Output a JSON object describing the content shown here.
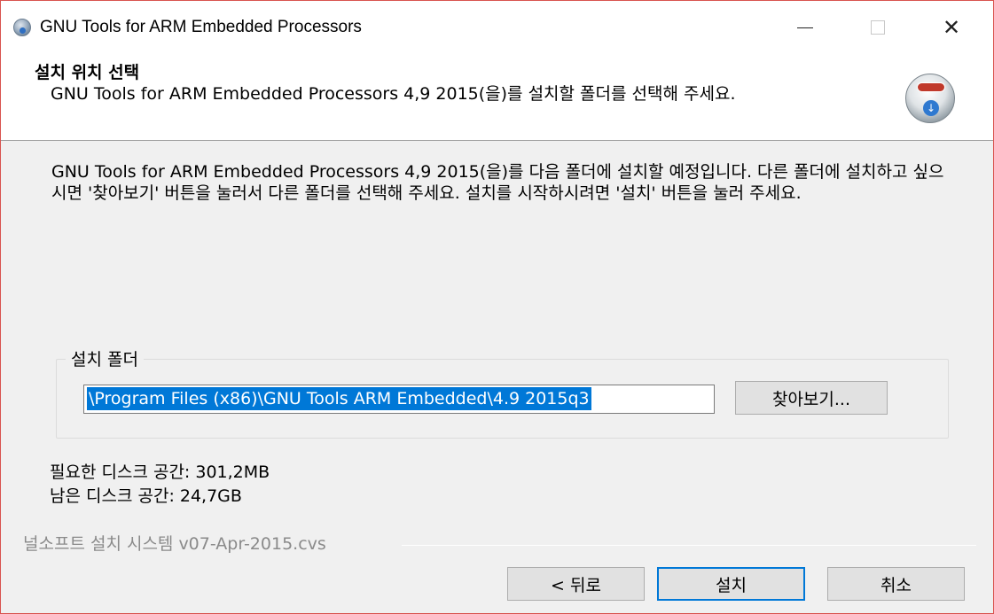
{
  "window": {
    "title": "GNU Tools for ARM Embedded Processors",
    "controls": [
      "minimize",
      "maximize",
      "close"
    ]
  },
  "header": {
    "heading": "설치 위치 선택",
    "subheading": "GNU Tools for ARM Embedded Processors 4,9 2015(을)를 설치할 폴더를 선택해 주세요.",
    "icon": "installer-icon"
  },
  "body": {
    "description": "GNU Tools for ARM Embedded Processors 4,9 2015(을)를 다음 폴더에 설치할 예정입니다. 다른 폴더에 설치하고 싶으시면 '찾아보기' 버튼을 눌러서 다른 폴더를 선택해 주세요. 설치를 시작하시려면 '설치' 버튼을 눌러 주세요.",
    "group_label": "설치 폴더",
    "install_path": "\\Program Files (x86)\\GNU Tools ARM Embedded\\4.9 2015q3",
    "browse_label": "찾아보기...",
    "required_space": "필요한 디스크 공간: 301,2MB",
    "available_space": "남은 디스크 공간: 24,7GB"
  },
  "footer": {
    "brand": "널소프트 설치 시스템 v07-Apr-2015.cvs",
    "back_label": "< 뒤로",
    "install_label": "설치",
    "cancel_label": "취소"
  }
}
